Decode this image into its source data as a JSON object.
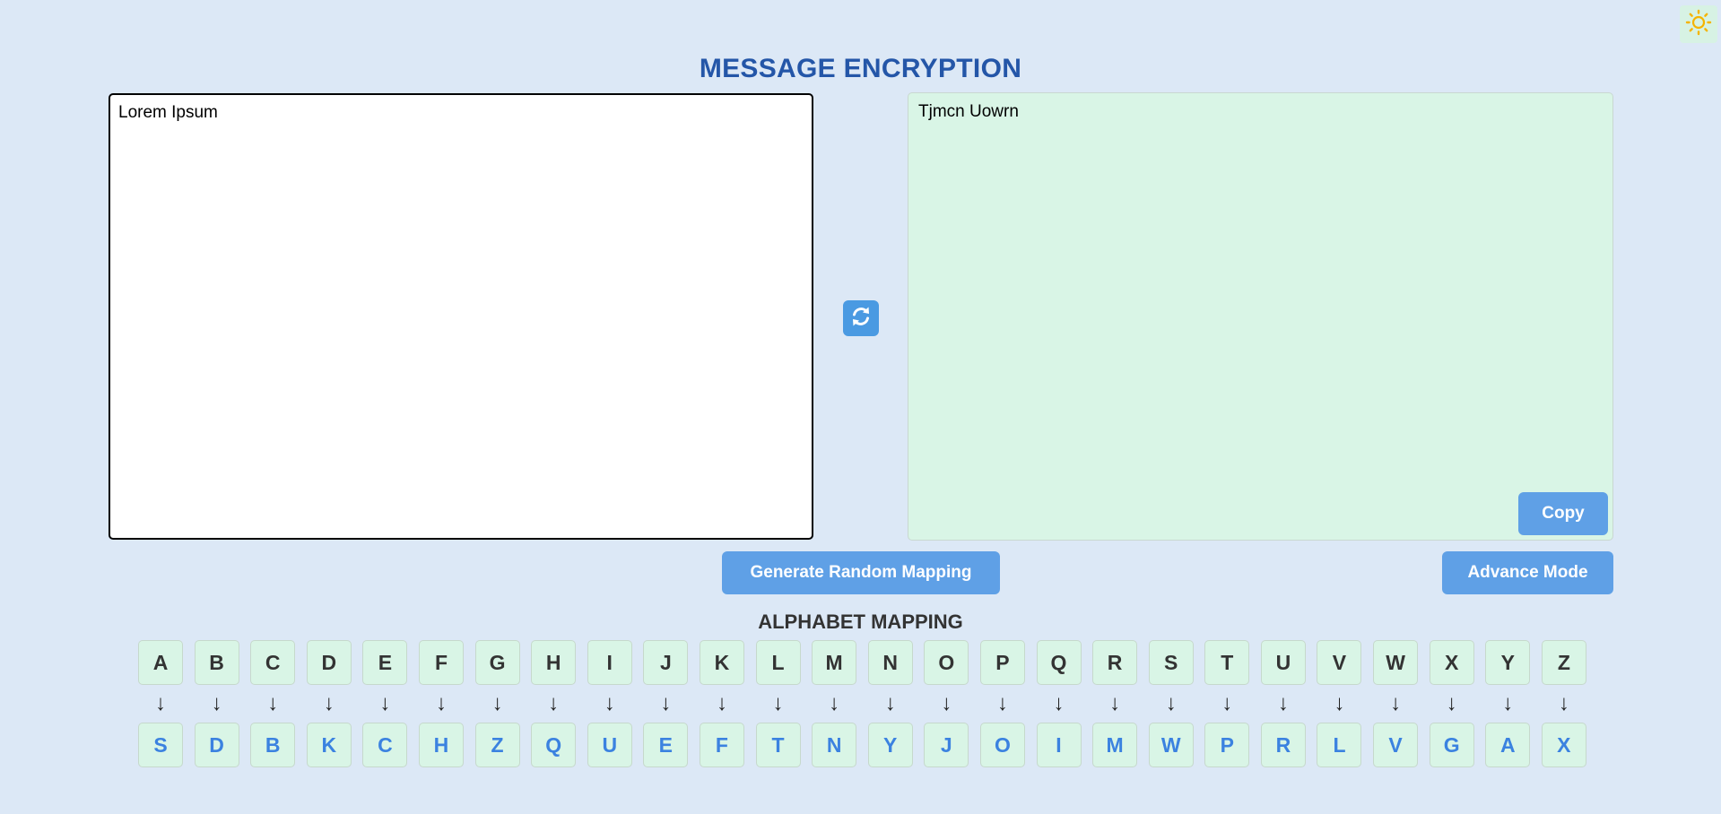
{
  "header": {
    "title": "MESSAGE ENCRYPTION",
    "theme_icon": "sun-icon",
    "theme_icon_color": "#f5b400"
  },
  "editor": {
    "input_text": "Lorem Ipsum",
    "output_text": "Tjmcn Uowrn",
    "swap_icon": "refresh-icon",
    "copy_label": "Copy"
  },
  "actions": {
    "generate_label": "Generate Random Mapping",
    "advance_label": "Advance Mode"
  },
  "mapping": {
    "title": "ALPHABET MAPPING",
    "arrow": "↓",
    "pairs": [
      {
        "from": "A",
        "to": "S"
      },
      {
        "from": "B",
        "to": "D"
      },
      {
        "from": "C",
        "to": "B"
      },
      {
        "from": "D",
        "to": "K"
      },
      {
        "from": "E",
        "to": "C"
      },
      {
        "from": "F",
        "to": "H"
      },
      {
        "from": "G",
        "to": "Z"
      },
      {
        "from": "H",
        "to": "Q"
      },
      {
        "from": "I",
        "to": "U"
      },
      {
        "from": "J",
        "to": "E"
      },
      {
        "from": "K",
        "to": "F"
      },
      {
        "from": "L",
        "to": "T"
      },
      {
        "from": "M",
        "to": "N"
      },
      {
        "from": "N",
        "to": "Y"
      },
      {
        "from": "O",
        "to": "J"
      },
      {
        "from": "P",
        "to": "O"
      },
      {
        "from": "Q",
        "to": "I"
      },
      {
        "from": "R",
        "to": "M"
      },
      {
        "from": "S",
        "to": "W"
      },
      {
        "from": "T",
        "to": "P"
      },
      {
        "from": "U",
        "to": "R"
      },
      {
        "from": "V",
        "to": "L"
      },
      {
        "from": "W",
        "to": "V"
      },
      {
        "from": "X",
        "to": "G"
      },
      {
        "from": "Y",
        "to": "A"
      },
      {
        "from": "Z",
        "to": "X"
      }
    ]
  },
  "colors": {
    "background": "#dce8f6",
    "title": "#2456a8",
    "button": "#5fa0e6",
    "output_bg": "#d9f5e6",
    "mapped_letter": "#3b82e0"
  }
}
